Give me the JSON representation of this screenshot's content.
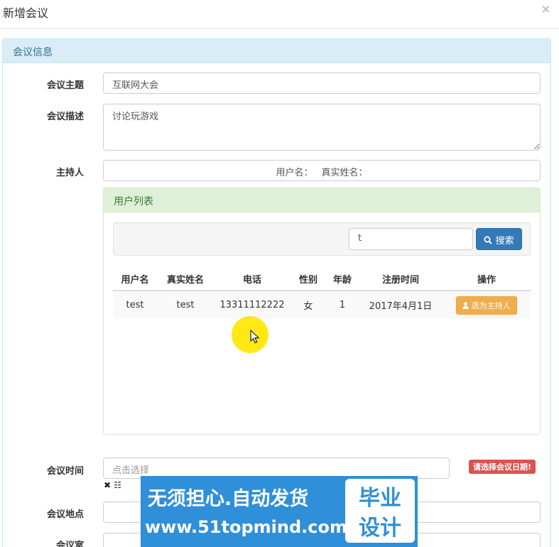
{
  "modal": {
    "title": "新增会议",
    "close": "×"
  },
  "panel": {
    "title": "会议信息"
  },
  "form": {
    "topic_label": "会议主题",
    "topic_value": "互联网大会",
    "desc_label": "会议描述",
    "desc_value": "讨论玩游戏",
    "host_label": "主持人",
    "host_username_label": "用户名：",
    "host_realname_label": "真实姓名：",
    "time_label": "会议时间",
    "time_placeholder": "点击选择",
    "time_error": "请选择会议日期!",
    "time_tools": "✖ ☷",
    "place_label": "会议地点",
    "room_label": "会议室"
  },
  "user_list": {
    "title": "用户列表",
    "search_value": "t",
    "search_button": "搜索",
    "columns": [
      "用户名",
      "真实姓名",
      "电话",
      "性别",
      "年龄",
      "注册时间",
      "操作"
    ],
    "rows": [
      {
        "username": "test",
        "realname": "test",
        "phone": "13311112222",
        "gender": "女",
        "age": "1",
        "registered": "2017年4月1日",
        "action": "选为主持人"
      }
    ]
  },
  "watermark": {
    "line1": "无须担心.自动发货",
    "line2": "www.51topmind.com",
    "box_line1": "毕业",
    "box_line2": "设计"
  },
  "colors": {
    "panel_heading": "#d9edf7",
    "sub_heading": "#dff0d8",
    "primary": "#337ab7",
    "warning": "#f0ad4e",
    "danger": "#d9534f",
    "watermark": "#2f8fd8"
  }
}
